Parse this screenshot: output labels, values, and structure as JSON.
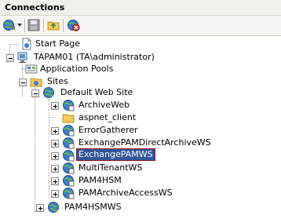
{
  "panel": {
    "title": "Connections"
  },
  "toolbar": {
    "buttons": [
      {
        "name": "connect-globe-icon"
      },
      {
        "name": "save-icon"
      },
      {
        "name": "up-folder-icon"
      },
      {
        "name": "disconnect-icon"
      }
    ]
  },
  "tree": {
    "start_page": "Start Page",
    "server": "TAPAM01 (TA\\administrator)",
    "app_pools": "Application Pools",
    "sites": "Sites",
    "default_site": "Default Web Site",
    "children": [
      {
        "label": "ArchiveWeb",
        "icon": "web-app-icon"
      },
      {
        "label": "aspnet_client",
        "icon": "folder-icon"
      },
      {
        "label": "ErrorGatherer",
        "icon": "web-app-icon"
      },
      {
        "label": "ExchangePAMDirectArchiveWS",
        "icon": "web-app-icon"
      },
      {
        "label": "ExchangePAMWS",
        "icon": "web-app-icon",
        "selected": true
      },
      {
        "label": "MultiTenantWS",
        "icon": "web-app-icon"
      },
      {
        "label": "PAM4HSM",
        "icon": "web-app-icon"
      },
      {
        "label": "PAMArchiveAccessWS",
        "icon": "web-app-icon"
      }
    ],
    "pam4hsmws": "PAM4HSMWS"
  },
  "colors": {
    "selection": "#31569c",
    "selection_border": "#9b1616"
  }
}
